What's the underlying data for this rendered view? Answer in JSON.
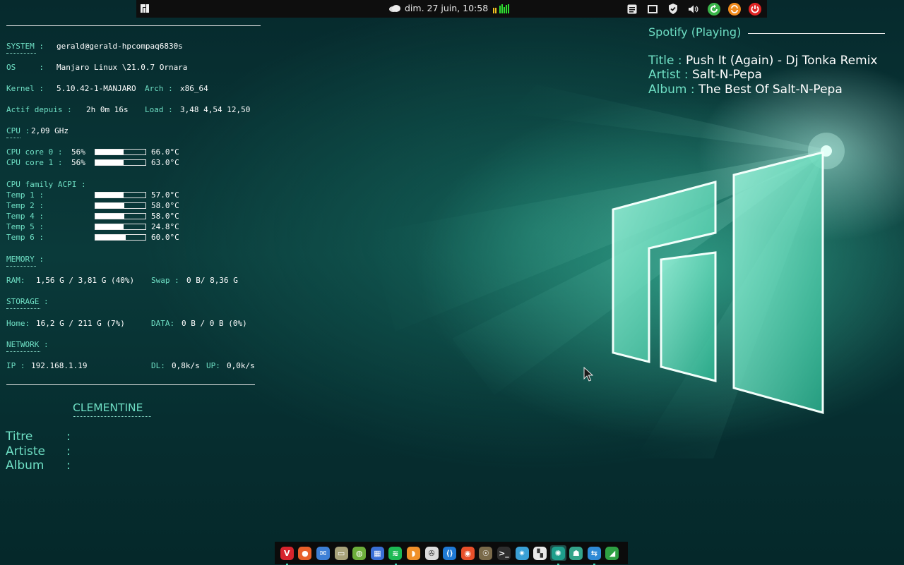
{
  "top_panel": {
    "clock": "dim. 27 juin, 10:58",
    "tray_icons": [
      "notes-icon",
      "window-icon",
      "shield-icon",
      "volume-icon",
      "update-icon",
      "sync-icon",
      "power-icon"
    ]
  },
  "conky": {
    "system_label": "SYSTEM :",
    "system_value": "gerald@gerald-hpcompaq6830s",
    "os_label": "OS     :",
    "os_value": "Manjaro Linux \\21.0.7 Ornara",
    "kernel_label": "Kernel :",
    "kernel_value": "5.10.42-1-MANJARO",
    "arch_label": "Arch :",
    "arch_value": "x86_64",
    "uptime_label": "Actif depuis :",
    "uptime_value": "2h 0m 16s",
    "load_label": "Load :",
    "load_value": "3,48 4,54 12,50",
    "cpu_label": "CPU :",
    "cpu_value": "2,09 GHz",
    "cores": [
      {
        "label": "CPU core 0 :",
        "usage": "56%",
        "fraction": 0.56,
        "temp": "66.0°C"
      },
      {
        "label": "CPU core 1 :",
        "usage": "56%",
        "fraction": 0.56,
        "temp": "63.0°C"
      }
    ],
    "acpi_label": "CPU family ACPI :",
    "temps": [
      {
        "label": "Temp 1 :",
        "value": "57.0°C",
        "fraction": 0.57
      },
      {
        "label": "Temp 2 :",
        "value": "58.0°C",
        "fraction": 0.58
      },
      {
        "label": "Temp 4 :",
        "value": "58.0°C",
        "fraction": 0.58
      },
      {
        "label": "Temp 5 :",
        "value": "24.8°C",
        "fraction": 0.57
      },
      {
        "label": "Temp 6 :",
        "value": "60.0°C",
        "fraction": 0.6
      }
    ],
    "memory_label": "MEMORY :",
    "ram_label": "RAM:",
    "ram_value": "1,56 G / 3,81 G (40%)",
    "swap_label": "Swap :",
    "swap_value": "0 B/ 8,36 G",
    "storage_label": "STORAGE :",
    "home_label": "Home:",
    "home_value": "16,2 G / 211 G (7%)",
    "data_label": "DATA:",
    "data_value": "0 B / 0 B (0%)",
    "network_label": "NETWORK :",
    "ip_label": "IP :",
    "ip_value": "192.168.1.19",
    "dl_label": "DL:",
    "dl_value": "0,8k/s",
    "up_label": "UP:",
    "up_value": "0,0k/s"
  },
  "clementine": {
    "title": "CLEMENTINE",
    "titre_label": "Titre",
    "artiste_label": "Artiste",
    "album_label": "Album",
    "separator": ":"
  },
  "spotify": {
    "header": "Spotify (Playing)",
    "title_label": "Title    :",
    "title_value": "Push It (Again) - Dj Tonka Remix",
    "artist_label": "Artist  :",
    "artist_value": "Salt-N-Pepa",
    "album_label": "Album :",
    "album_value": "The Best Of Salt-N-Pepa"
  },
  "dock": {
    "apps": [
      {
        "name": "vivaldi-icon",
        "color": "#d7242d",
        "glyph": "V",
        "running": true
      },
      {
        "name": "firefox-icon",
        "color": "#e8602a",
        "glyph": "●",
        "running": false
      },
      {
        "name": "mail-icon",
        "color": "#3d7fd6",
        "glyph": "✉",
        "running": false
      },
      {
        "name": "files-icon",
        "color": "#a8a27a",
        "glyph": "▭",
        "running": false
      },
      {
        "name": "keepass-icon",
        "color": "#6cae3a",
        "glyph": "◍",
        "running": false
      },
      {
        "name": "calculator-icon",
        "color": "#3a6fd6",
        "glyph": "▦",
        "running": false
      },
      {
        "name": "spotify-icon",
        "color": "#1db954",
        "glyph": "≋",
        "running": true
      },
      {
        "name": "clementine-icon",
        "color": "#f0902a",
        "glyph": "◗",
        "running": false
      },
      {
        "name": "film-reel-icon",
        "color": "#dcdcdc",
        "glyph": "✇",
        "running": false
      },
      {
        "name": "vscode-icon",
        "color": "#1f7ad6",
        "glyph": "⟨⟩",
        "running": false
      },
      {
        "name": "brave-browser-icon",
        "color": "#e8502a",
        "glyph": "◉",
        "running": false
      },
      {
        "name": "gimp-icon",
        "color": "#7a6a4a",
        "glyph": "☉",
        "running": false
      },
      {
        "name": "terminal-icon",
        "color": "#2e2e2e",
        "glyph": ">_",
        "running": false
      },
      {
        "name": "kde-connect-icon",
        "color": "#3aa0d6",
        "glyph": "✷",
        "running": false
      },
      {
        "name": "software-center-icon",
        "color": "#e8e8e8",
        "glyph": "▚",
        "running": false
      },
      {
        "name": "aperture-icon",
        "color": "#1e9f8c",
        "glyph": "✺",
        "running": true
      },
      {
        "name": "manjaro-hello-icon",
        "color": "#34a48a",
        "glyph": "☗",
        "running": false
      },
      {
        "name": "network-icon",
        "color": "#2f8ad6",
        "glyph": "⇆",
        "running": true
      },
      {
        "name": "system-monitor-icon",
        "color": "#2ea043",
        "glyph": "◢",
        "running": false
      }
    ]
  }
}
